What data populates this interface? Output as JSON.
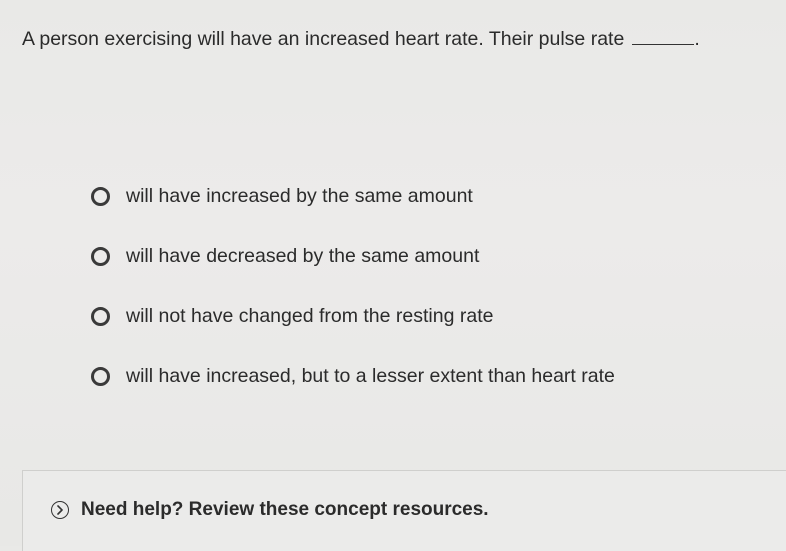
{
  "question": {
    "text": "A person exercising will have an increased heart rate. Their pulse rate",
    "trailing_punct": "."
  },
  "options": [
    {
      "label": "will have increased by the same amount"
    },
    {
      "label": "will have decreased by the same amount"
    },
    {
      "label": "will not have changed from the resting rate"
    },
    {
      "label": "will have increased, but to a lesser extent than heart rate"
    }
  ],
  "help": {
    "label": "Need help? Review these concept resources.",
    "icon": "chevron-right-circle-icon"
  }
}
